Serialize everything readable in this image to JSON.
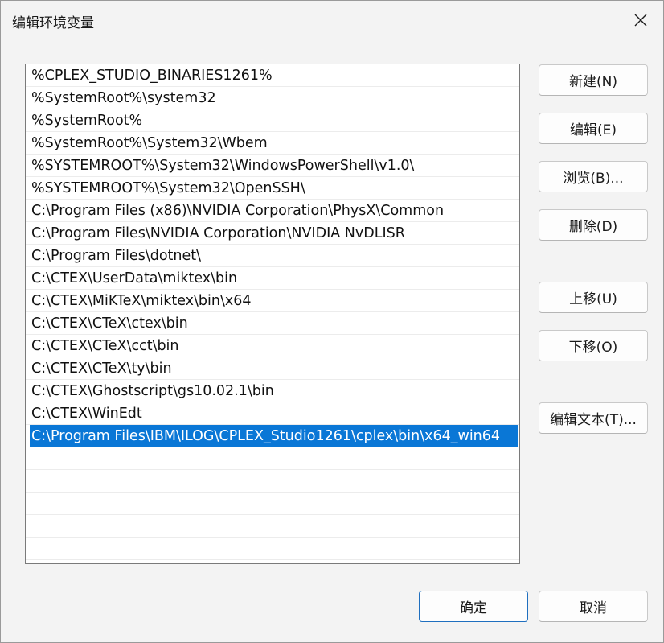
{
  "window": {
    "title": "编辑环境变量"
  },
  "path_list": {
    "items": [
      "%CPLEX_STUDIO_BINARIES1261%",
      "%SystemRoot%\\system32",
      "%SystemRoot%",
      "%SystemRoot%\\System32\\Wbem",
      "%SYSTEMROOT%\\System32\\WindowsPowerShell\\v1.0\\",
      "%SYSTEMROOT%\\System32\\OpenSSH\\",
      "C:\\Program Files (x86)\\NVIDIA Corporation\\PhysX\\Common",
      "C:\\Program Files\\NVIDIA Corporation\\NVIDIA NvDLISR",
      "C:\\Program Files\\dotnet\\",
      "C:\\CTEX\\UserData\\miktex\\bin",
      "C:\\CTEX\\MiKTeX\\miktex\\bin\\x64",
      "C:\\CTEX\\CTeX\\ctex\\bin",
      "C:\\CTEX\\CTeX\\cct\\bin",
      "C:\\CTEX\\CTeX\\ty\\bin",
      "C:\\CTEX\\Ghostscript\\gs10.02.1\\bin",
      "C:\\CTEX\\WinEdt",
      "C:\\Program Files\\IBM\\ILOG\\CPLEX_Studio1261\\cplex\\bin\\x64_win64"
    ],
    "selected_index": 16,
    "empty_rows": 5
  },
  "buttons": {
    "new": "新建(N)",
    "edit": "编辑(E)",
    "browse": "浏览(B)...",
    "delete": "删除(D)",
    "move_up": "上移(U)",
    "move_down": "下移(O)",
    "edit_text": "编辑文本(T)...",
    "ok": "确定",
    "cancel": "取消"
  },
  "colors": {
    "selection": "#0a77d6",
    "primary_border": "#1f6fbf"
  },
  "icons": {
    "close": "close-icon"
  }
}
